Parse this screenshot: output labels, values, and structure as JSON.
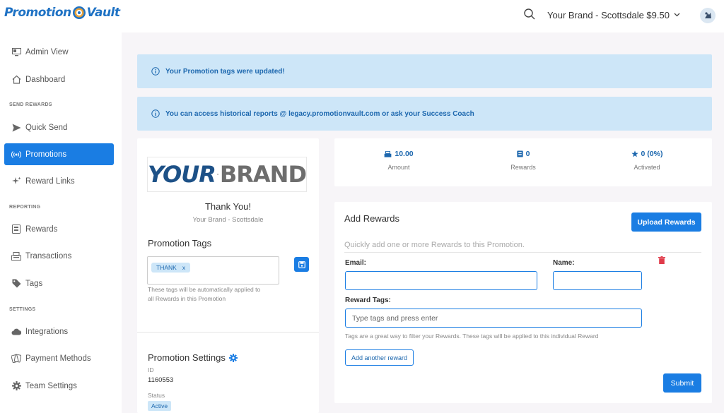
{
  "app": {
    "logo_left": "Promotion",
    "logo_right": "Vault"
  },
  "sidebar": {
    "items": [
      {
        "label": "Admin View",
        "icon": "monitor-icon"
      },
      {
        "label": "Dashboard",
        "icon": "home-icon"
      },
      {
        "label": "Quick Send",
        "icon": "send-icon"
      },
      {
        "label": "Promotions",
        "icon": "broadcast-icon",
        "active": true
      },
      {
        "label": "Reward Links",
        "icon": "sparkle-icon"
      },
      {
        "label": "Rewards",
        "icon": "rewards-icon"
      },
      {
        "label": "Transactions",
        "icon": "register-icon"
      },
      {
        "label": "Tags",
        "icon": "tag-icon"
      },
      {
        "label": "Integrations",
        "icon": "cloud-icon"
      },
      {
        "label": "Payment Methods",
        "icon": "cards-icon"
      },
      {
        "label": "Team Settings",
        "icon": "gear-icon"
      }
    ],
    "sections": {
      "send_rewards": "SEND REWARDS",
      "reporting": "REPORTING",
      "settings": "SETTINGS"
    }
  },
  "topbar": {
    "brand_selector": "Your Brand - Scottsdale $9.50"
  },
  "alerts": [
    "Your Promotion tags were updated!",
    "You can access historical reports @ legacy.promotionvault.com or ask your Success Coach"
  ],
  "promotion": {
    "logo_word_1": "YOUR",
    "logo_word_2": "BRAND",
    "thank_you": "Thank You!",
    "brand_name": "Your Brand - Scottsdale",
    "tags_title": "Promotion Tags",
    "tags": [
      {
        "label": "THANK"
      }
    ],
    "tags_remove_glyph": "x",
    "tags_help_line1": "These tags will be automatically applied to",
    "tags_help_line2": "all Rewards in this Promotion",
    "settings_title": "Promotion Settings",
    "id_label": "ID",
    "id_value": "1160553",
    "status_label": "Status",
    "status_value": "Active"
  },
  "stats": [
    {
      "value": "10.00",
      "label": "Amount",
      "icon": "register-icon"
    },
    {
      "value": "0",
      "label": "Rewards",
      "icon": "rewards-icon"
    },
    {
      "value": "0 (0%)",
      "label": "Activated",
      "icon": "star-icon"
    }
  ],
  "add_rewards": {
    "title": "Add Rewards",
    "upload_label": "Upload Rewards",
    "description": "Quickly add one or more Rewards to this Promotion.",
    "email_label": "Email:",
    "email_value": "",
    "name_label": "Name:",
    "name_value": "",
    "tags_label": "Reward Tags:",
    "tags_placeholder": "Type tags and press enter",
    "tags_help": "Tags are a great way to filter your Rewards. These tags will be applied to this individual Reward",
    "add_another_label": "Add another reward",
    "submit_label": "Submit"
  },
  "colors": {
    "accent": "#1a7de3",
    "alert_bg": "#cde6f8",
    "alert_text": "#1c67ae",
    "danger": "#e03b4a"
  }
}
